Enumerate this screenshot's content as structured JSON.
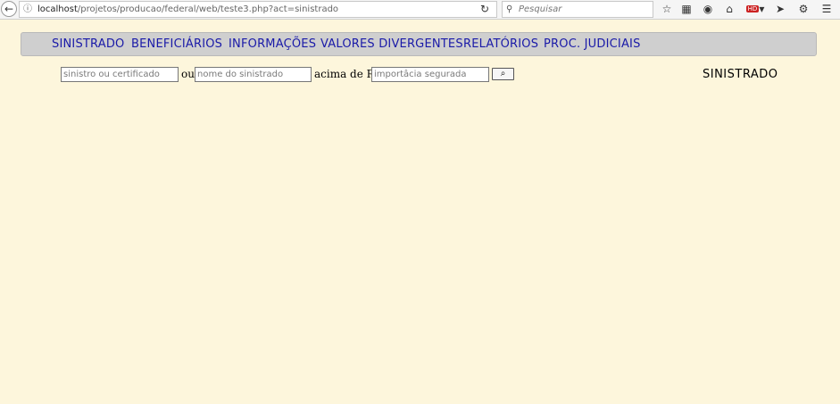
{
  "browser": {
    "url_host": "localhost",
    "url_path": "/projetos/producao/federal/web/teste3.php?act=sinistrado",
    "search_placeholder": "Pesquisar"
  },
  "nav": {
    "items": [
      {
        "label": "SINISTRADO"
      },
      {
        "label": "BENEFICIÁRIOS"
      },
      {
        "label": "INFORMAÇÕES"
      },
      {
        "label": "VALORES DIVERGENTES"
      },
      {
        "label": "RELATÓRIOS"
      },
      {
        "label": "PROC. JUDICIAIS"
      }
    ]
  },
  "search_form": {
    "certificate_placeholder": "sinistro ou certificado",
    "or_label": "ou",
    "name_placeholder": "nome do sinistrado",
    "above_label": "acima de R$",
    "amount_placeholder": "importâcia segurada",
    "search_button_label": "⌕"
  },
  "page_title": "SINISTRADO"
}
